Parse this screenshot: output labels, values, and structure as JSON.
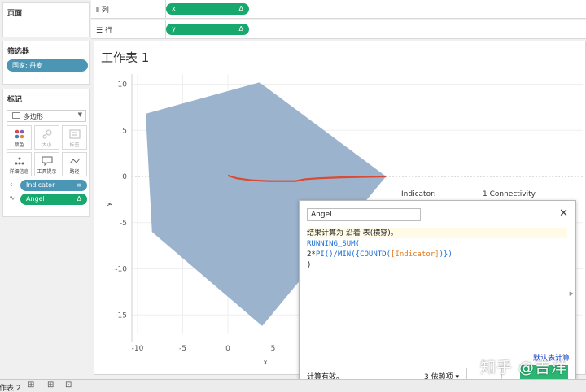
{
  "left": {
    "pages_title": "页面",
    "filters_title": "筛选器",
    "filter_pill": "国家: 丹麦",
    "marks_title": "标记",
    "marks_type": "多边形",
    "mark_buttons": [
      "颜色",
      "大小",
      "标签",
      "详细信息",
      "工具提示",
      "路径"
    ],
    "mark_fields": [
      {
        "label": "Indicator",
        "icon": "sort-icon"
      },
      {
        "label": "Angel",
        "icon": "delta-icon"
      }
    ]
  },
  "shelves": {
    "columns_label": "列",
    "rows_label": "行",
    "columns_pill": "x",
    "rows_pill": "y",
    "delta": "Δ"
  },
  "sheet": {
    "title": "工作表 1",
    "y_label": "y",
    "x_label": "x",
    "y_ticks": [
      "10",
      "5",
      "0",
      "-5",
      "-10",
      "-15"
    ],
    "x_ticks": [
      "-10",
      "-5",
      "0",
      "5"
    ]
  },
  "chart_data": {
    "type": "area",
    "polygon": {
      "x": [
        -9.1,
        3.5,
        17.5,
        3.8,
        -8.4
      ],
      "y": [
        6.8,
        10.2,
        0.0,
        -16.2,
        -6.0
      ]
    },
    "line": {
      "x": [
        0.0,
        1.0,
        2.5,
        4.5,
        7.5,
        8.5,
        10.0,
        12.5,
        15.0,
        17.5
      ],
      "y": [
        0.1,
        -0.2,
        -0.4,
        -0.5,
        -0.5,
        -0.3,
        -0.2,
        -0.1,
        -0.05,
        0.0
      ]
    },
    "xlabel": "x",
    "ylabel": "y",
    "xlim": [
      -11,
      22
    ],
    "ylim": [
      -17,
      11
    ],
    "colors": {
      "polygon": "#9bb3cd",
      "line": "#d94b35"
    }
  },
  "tooltip": {
    "key": "Indicator:",
    "value": "1 Connectivity"
  },
  "dialog": {
    "name": "Angel",
    "comment": "结果计算为 沿着 表(横穿)。",
    "code": {
      "l1_fn": "RUNNING_SUM(",
      "l2_a": "2*",
      "l2_b": "PI",
      "l2_c": "()/",
      "l2_d": "MIN",
      "l2_e": "({",
      "l2_f": "COUNTD",
      "l2_g": "(",
      "l2_h": "[Indicator]",
      "l2_i": ")})",
      "l3": ")"
    },
    "status": "计算有效。",
    "deps": "3 依赖项 ▾",
    "default_link": "默认表计算",
    "close": "✕"
  },
  "bottom": {
    "sheet_tab": "作表 2"
  },
  "watermark": "知乎 @吉洋",
  "colors": {
    "accent_green": "#17a86d",
    "accent_blue": "#4b96b4"
  }
}
